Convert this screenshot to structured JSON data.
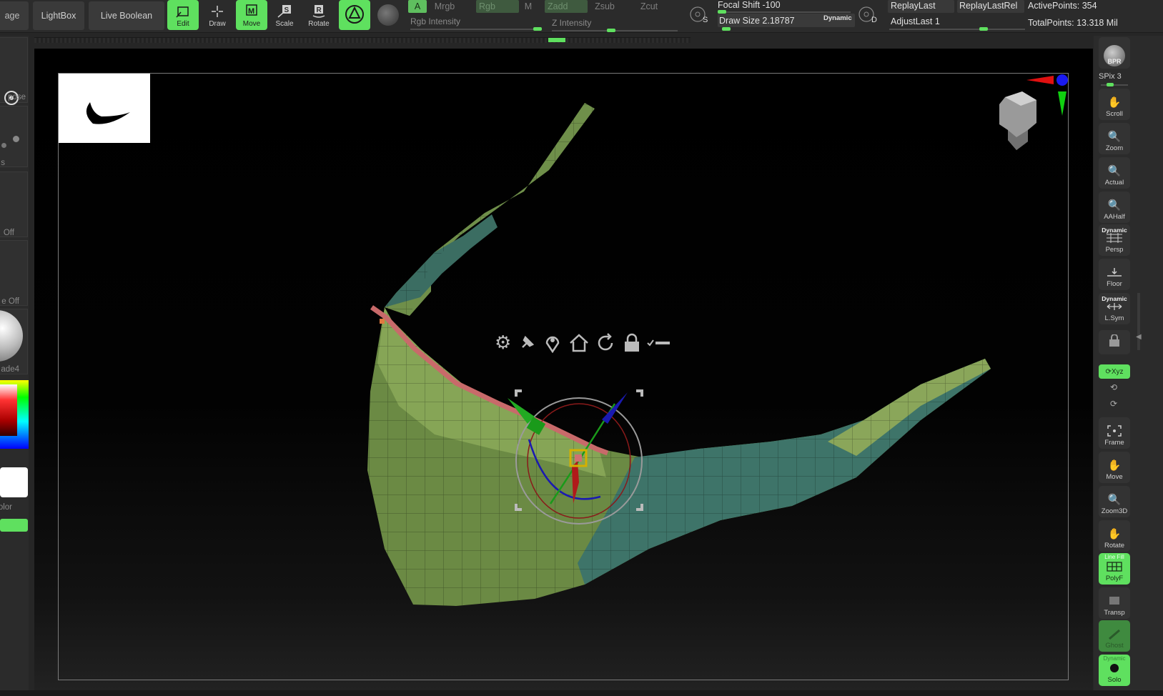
{
  "topbar": {
    "left_fragment": "age",
    "lightbox": "LightBox",
    "live_boolean": "Live Boolean",
    "tools": [
      {
        "label": "Edit",
        "active": true
      },
      {
        "label": "Draw",
        "active": false
      },
      {
        "label": "Move",
        "active": true
      },
      {
        "label": "Scale",
        "active": false
      },
      {
        "label": "Rotate",
        "active": false
      }
    ],
    "channels": {
      "a": "A",
      "mrgb": "Mrgb",
      "rgb": "Rgb",
      "m": "M",
      "zadd": "Zadd",
      "zsub": "Zsub",
      "zcut": "Zcut"
    },
    "rgb_intensity": "Rgb Intensity",
    "z_intensity": "Z Intensity",
    "focal_shift": "Focal Shift -100",
    "draw_size": "Draw Size 2.18787",
    "dynamic": "Dynamic",
    "s_key": "S",
    "d_key": "D",
    "replay_last": "ReplayLast",
    "replay_last_rel": "ReplayLastRel",
    "adjust_last": "AdjustLast 1",
    "active_points": "ActivePoints: 354",
    "total_points": "TotalPoints: 13.318 Mil"
  },
  "left_panel": {
    "pose": "pose",
    "s": "s",
    "off1": "Off",
    "off2": "e Off",
    "material": "ade4",
    "color": "olor"
  },
  "right_panel": {
    "bpr": "BPR",
    "spix": "SPix 3",
    "scroll": "Scroll",
    "zoom": "Zoom",
    "actual": "Actual",
    "aahalf": "AAHalf",
    "dynamic1": "Dynamic",
    "persp": "Persp",
    "floor": "Floor",
    "dynamic2": "Dynamic",
    "lsym": "L.Sym",
    "xyz": "Xyz",
    "frame": "Frame",
    "move": "Move",
    "zoom3d": "Zoom3D",
    "rotate": "Rotate",
    "line_fill": "Line Fill",
    "polyf": "PolyF",
    "transp": "Transp",
    "ghost": "Ghost",
    "dynamic3": "Dynamic",
    "solo": "Solo"
  },
  "colors": {
    "accent": "#5fe05f",
    "mesh_green": "#7a9a50",
    "mesh_teal": "#3f7f6f",
    "mask_red": "#c86a6a"
  }
}
